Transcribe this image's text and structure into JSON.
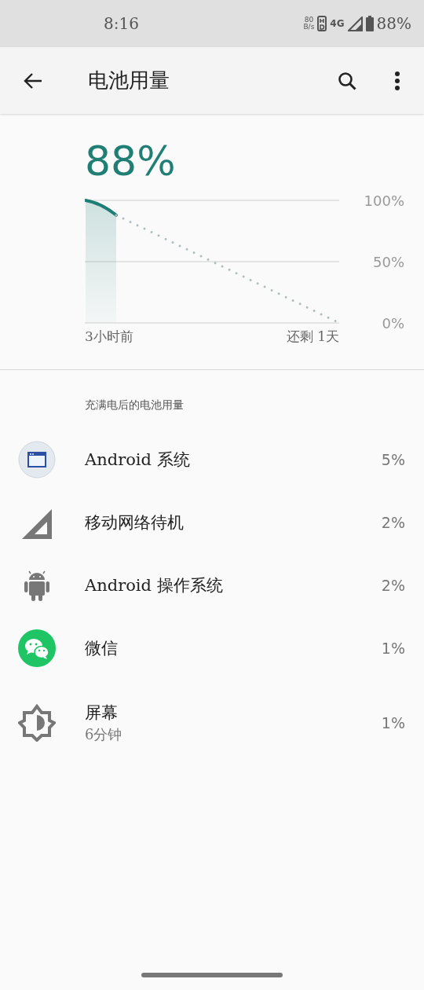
{
  "status_bar": {
    "time": "8:16",
    "speed_value": "80",
    "speed_unit": "B/s",
    "network": "4G",
    "battery": "88%"
  },
  "app_bar": {
    "title": "电池用量"
  },
  "battery": {
    "percent": "88%",
    "scale_labels": [
      "100%",
      "50%",
      "0%"
    ],
    "time_labels": [
      "3小时前",
      "还剩 1天"
    ]
  },
  "section_title": "充满电后的电池用量",
  "apps": [
    {
      "name": "Android 系统",
      "percent": "5%"
    },
    {
      "name": "移动网络待机",
      "percent": "2%"
    },
    {
      "name": "Android 操作系统",
      "percent": "2%"
    },
    {
      "name": "微信",
      "percent": "1%"
    },
    {
      "name": "屏幕",
      "subtitle": "6分钟",
      "percent": "1%"
    }
  ]
}
